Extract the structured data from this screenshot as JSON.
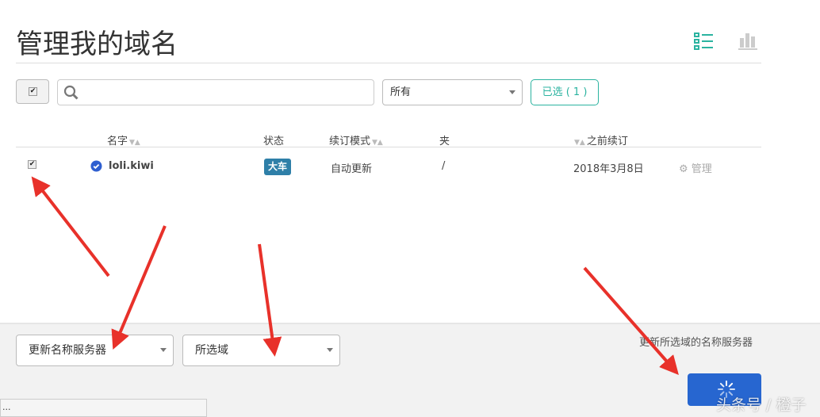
{
  "page": {
    "title": "管理我的域名"
  },
  "toolbar": {
    "search_placeholder": "",
    "filter_value": "所有",
    "selected_label": "已选 ( 1 )"
  },
  "table": {
    "headers": [
      "名字",
      "状态",
      "续订模式",
      "夹",
      "之前续订"
    ],
    "rows": [
      {
        "name": "loli.kiwi",
        "status": "大车",
        "renew_mode": "自动更新",
        "folder": "/",
        "prev_renew": "2018年3月8日",
        "manage": "管理",
        "checked": true
      }
    ]
  },
  "bottom": {
    "action_value": "更新名称服务器",
    "scope_value": "所选域",
    "hint": "更新所选域的名称服务器",
    "status_text": "..."
  },
  "watermark": "头条号 / 橙子",
  "colors": {
    "accent": "#2bb3a0",
    "badge": "#2e7fa8",
    "primary": "#2766d0",
    "arrow": "#e8312a"
  }
}
